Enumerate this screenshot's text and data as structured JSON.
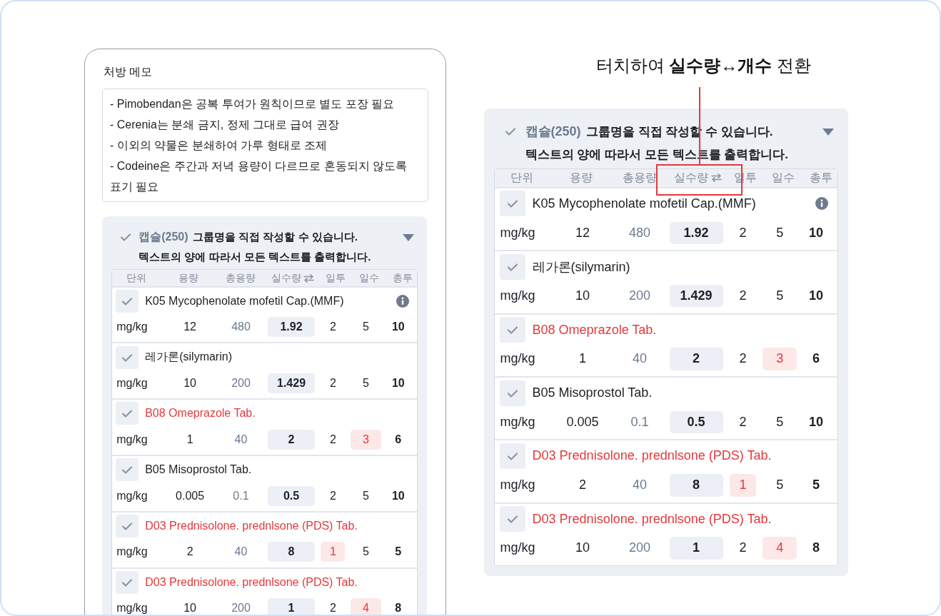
{
  "prescription_screen": {
    "memo_label": "처방 메모",
    "memo_lines": [
      "- Pimobendan은 공복 투여가 원칙이므로 별도 포장 필요",
      "- Cerenia는 분쇄 금지, 정제 그대로 급여 권장",
      "- 이외의 약물은 분쇄하여 가루 형태로 조제",
      "- Codeine은 주간과 저녁 용량이 다르므로 혼동되지 않도록 표기 필요"
    ],
    "group": {
      "checked": true,
      "name": "캡슐(250)",
      "description_lines": [
        "그룹명을 직접 작성할 수 있습니다.",
        "텍스트의 양에 따라서 모든 텍스트를 출력합니다."
      ],
      "columns": [
        {
          "label": "단위",
          "kind": "plain",
          "highlighted": false
        },
        {
          "label": "용량",
          "kind": "plain",
          "highlighted": false
        },
        {
          "label": "총용량",
          "kind": "plain",
          "highlighted": false
        },
        {
          "label": "실수량",
          "kind": "swap",
          "highlighted": false
        },
        {
          "label": "일투",
          "kind": "plain",
          "highlighted": false
        },
        {
          "label": "일수",
          "kind": "plain",
          "highlighted": false
        },
        {
          "label": "총투",
          "kind": "plain",
          "highlighted": false
        }
      ],
      "rows": [
        {
          "checked": true,
          "name": "K05 Mycophenolate mofetil Cap.(MMF)",
          "alert": false,
          "info": true,
          "unit": "mg/kg",
          "dose": "12",
          "total": "480",
          "actual": "1.92",
          "daily": "2",
          "days": "5",
          "count": "10",
          "daily_flagged": false,
          "days_flagged": false
        },
        {
          "checked": true,
          "name": "레가론(silymarin)",
          "alert": false,
          "info": false,
          "unit": "mg/kg",
          "dose": "10",
          "total": "200",
          "actual": "1.429",
          "daily": "2",
          "days": "5",
          "count": "10",
          "daily_flagged": false,
          "days_flagged": false
        },
        {
          "checked": true,
          "name": "B08 Omeprazole Tab.",
          "alert": true,
          "info": false,
          "unit": "mg/kg",
          "dose": "1",
          "total": "40",
          "actual": "2",
          "daily": "2",
          "days": "3",
          "count": "6",
          "daily_flagged": false,
          "days_flagged": true
        },
        {
          "checked": true,
          "name": "B05 Misoprostol Tab.",
          "alert": false,
          "info": false,
          "unit": "mg/kg",
          "dose": "0.005",
          "total": "0.1",
          "actual": "0.5",
          "daily": "2",
          "days": "5",
          "count": "10",
          "daily_flagged": false,
          "days_flagged": false
        },
        {
          "checked": true,
          "name": "D03 Prednisolone. prednlsone (PDS) Tab.",
          "alert": true,
          "info": false,
          "unit": "mg/kg",
          "dose": "2",
          "total": "40",
          "actual": "8",
          "daily": "1",
          "days": "5",
          "count": "5",
          "daily_flagged": true,
          "days_flagged": false
        },
        {
          "checked": true,
          "name": "D03 Prednisolone. prednlsone (PDS) Tab.",
          "alert": true,
          "info": false,
          "unit": "mg/kg",
          "dose": "10",
          "total": "200",
          "actual": "1",
          "daily": "2",
          "days": "4",
          "count": "8",
          "daily_flagged": false,
          "days_flagged": true
        }
      ]
    }
  },
  "toggle_hint": {
    "text": "터치하여 **실수량↔개수** 전환"
  },
  "detail_group": {
    "checked": true,
    "name": "캡슐(250)",
    "description_lines": [
      "그룹명을 직접 작성할 수 있습니다.",
      "텍스트의 양에 따라서 모든 텍스트를 출력합니다."
    ],
    "columns": [
      {
        "label": "단위",
        "kind": "plain",
        "highlighted": false
      },
      {
        "label": "용량",
        "kind": "plain",
        "highlighted": false
      },
      {
        "label": "총용량",
        "kind": "plain",
        "highlighted": false
      },
      {
        "label": "실수량",
        "kind": "swap",
        "highlighted": true
      },
      {
        "label": "일투",
        "kind": "plain",
        "highlighted": false
      },
      {
        "label": "일수",
        "kind": "plain",
        "highlighted": false
      },
      {
        "label": "총투",
        "kind": "plain",
        "highlighted": false
      }
    ],
    "rows": [
      {
        "checked": true,
        "name": "K05 Mycophenolate mofetil Cap.(MMF)",
        "alert": false,
        "info": true,
        "unit": "mg/kg",
        "dose": "12",
        "total": "480",
        "actual": "1.92",
        "daily": "2",
        "days": "5",
        "count": "10",
        "daily_flagged": false,
        "days_flagged": false
      },
      {
        "checked": true,
        "name": "레가론(silymarin)",
        "alert": false,
        "info": false,
        "unit": "mg/kg",
        "dose": "10",
        "total": "200",
        "actual": "1.429",
        "daily": "2",
        "days": "5",
        "count": "10",
        "daily_flagged": false,
        "days_flagged": false
      },
      {
        "checked": true,
        "name": "B08 Omeprazole Tab.",
        "alert": true,
        "info": false,
        "unit": "mg/kg",
        "dose": "1",
        "total": "40",
        "actual": "2",
        "daily": "2",
        "days": "3",
        "count": "6",
        "daily_flagged": false,
        "days_flagged": true
      },
      {
        "checked": true,
        "name": "B05 Misoprostol Tab.",
        "alert": false,
        "info": false,
        "unit": "mg/kg",
        "dose": "0.005",
        "total": "0.1",
        "actual": "0.5",
        "daily": "2",
        "days": "5",
        "count": "10",
        "daily_flagged": false,
        "days_flagged": false
      },
      {
        "checked": true,
        "name": "D03 Prednisolone. prednlsone (PDS) Tab.",
        "alert": true,
        "info": false,
        "unit": "mg/kg",
        "dose": "2",
        "total": "40",
        "actual": "8",
        "daily": "1",
        "days": "5",
        "count": "5",
        "daily_flagged": true,
        "days_flagged": false
      },
      {
        "checked": true,
        "name": "D03 Prednisolone. prednlsone (PDS) Tab.",
        "alert": true,
        "info": false,
        "unit": "mg/kg",
        "dose": "10",
        "total": "200",
        "actual": "1",
        "daily": "2",
        "days": "4",
        "count": "8",
        "daily_flagged": false,
        "days_flagged": true
      }
    ]
  }
}
